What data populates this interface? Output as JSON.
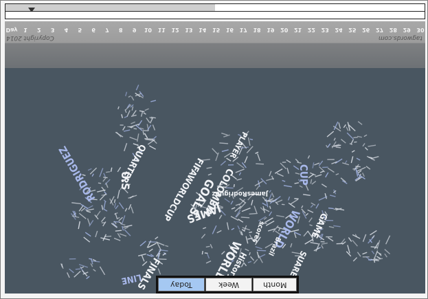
{
  "timeline": {
    "slider_fraction": 0.05,
    "filled_fraction": 0.5
  },
  "days": {
    "label": "Day",
    "ticks": [
      "1",
      "2",
      "3",
      "4",
      "5",
      "6",
      "7",
      "8",
      "9",
      "10",
      "11",
      "12",
      "13",
      "14",
      "15",
      "16",
      "17",
      "18",
      "19",
      "20",
      "21",
      "22",
      "23",
      "24",
      "25",
      "26",
      "27",
      "28",
      "29",
      "30"
    ]
  },
  "footer": {
    "copyright": "Copyright 2014",
    "site": "tagwords.com"
  },
  "word_cloud": {
    "words": [
      "U.S",
      "QUARTER",
      "RODRIGUEZ",
      "FINALS",
      "LINE",
      "GOALS",
      "COLOMBIA",
      "PLAYER",
      "FIFAWORLDCUP",
      "JamesRodriguez",
      "CUP",
      "WORLD",
      "GAME",
      "JAMES",
      "WORLDCUP",
      "SUAREZ",
      "Brazil",
      "History",
      "scores"
    ]
  },
  "period_tabs": [
    "Today",
    "Week",
    "Month"
  ],
  "colors": {
    "map_bg": "#495661",
    "active_tab": "#a5c8f2"
  }
}
